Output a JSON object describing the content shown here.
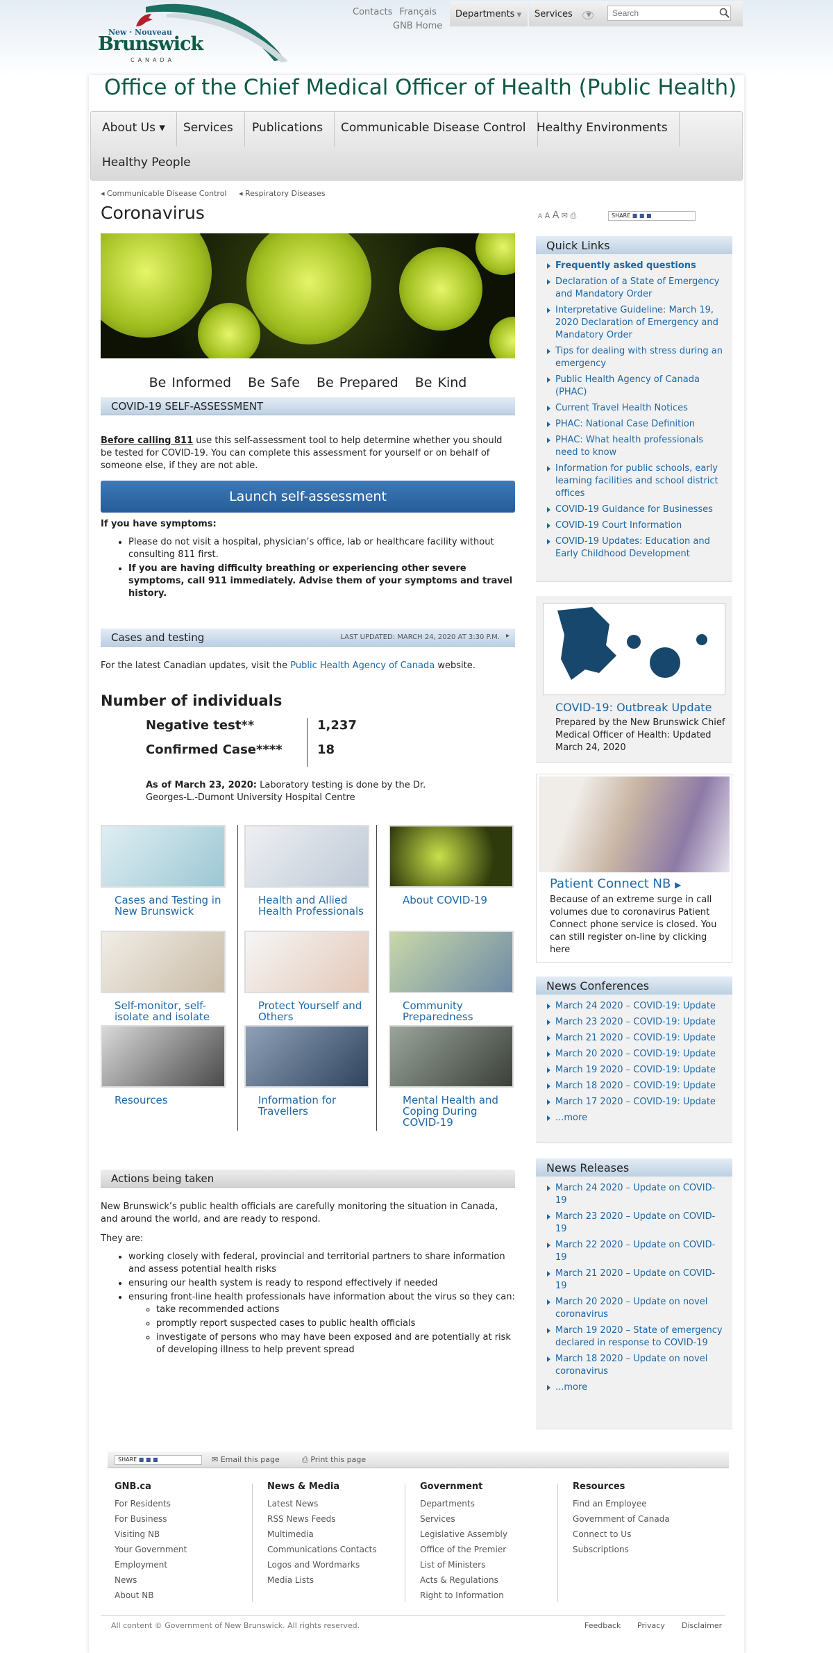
{
  "header": {
    "logo_top": "New · Nouveau",
    "logo_main": "Brunswick",
    "logo_country": "CANADA",
    "contacts": "Contacts",
    "francais": "Français",
    "gnb_home": "GNB Home",
    "departments": "Departments",
    "services": "Services",
    "search_placeholder": "Search"
  },
  "site_title": "Office of the Chief Medical Officer of Health (Public Health)",
  "menu": {
    "about": "About Us ▾",
    "services": "Services",
    "publications": "Publications",
    "cdc": "Communicable Disease Control",
    "env": "Healthy Environments",
    "people": "Healthy People"
  },
  "breadcrumb": [
    "Communicable Disease Control",
    "Respiratory Diseases"
  ],
  "page_title": "Coronavirus",
  "tagline": [
    "Be Informed",
    "Be Safe",
    "Be Prepared",
    "Be Kind"
  ],
  "self_assessment": {
    "heading": "COVID-19 SELF-ASSESSMENT",
    "lead_bold": "Before calling 811",
    "lead": " use this self-assessment tool to help determine whether you should be tested for COVID-19. You can complete this assessment for yourself or on behalf of someone else, if they are not able.",
    "button": "Launch self-assessment",
    "symptoms_heading": "If you have symptoms:",
    "bullet1": "Please do not visit a hospital, physician’s office, lab or healthcare facility without consulting 811 first.",
    "bullet2": "If you are having difficulty breathing or experiencing other severe symptoms, call 911 immediately. Advise them of your symptoms and travel history."
  },
  "cases": {
    "heading": "Cases and testing",
    "updated": "LAST UPDATED: MARCH 24, 2020 AT 3:30 P.M.",
    "intro_a": "For the latest Canadian updates, visit the ",
    "intro_link": "Public Health Agency of Canada",
    "intro_b": " website.",
    "num_heading": "Number of individuals",
    "neg_label": "Negative test**",
    "neg_value": "1,237",
    "conf_label": "Confirmed Case****",
    "conf_value": "18",
    "note_bold": "As of March 23, 2020:",
    "note": " Laboratory testing is done by the Dr. Georges-L.-Dumont University Hospital Centre"
  },
  "tiles": [
    "Cases and Testing in New Brunswick",
    "Health and Allied Health Professionals",
    "About COVID-19",
    "Self-monitor, self-isolate and isolate",
    "Protect Yourself and Others",
    "Community Preparedness",
    "Resources",
    "Information for Travellers",
    "Mental Health and Coping During COVID-19"
  ],
  "actions": {
    "heading": "Actions being taken",
    "p1": "New Brunswick’s public health officials are carefully monitoring the situation in Canada, and around the world, and are ready to respond.",
    "p2": "They are:",
    "items": [
      "working closely with federal, provincial and territorial partners to share information and assess potential health risks",
      "ensuring our health system is ready to respond effectively if needed",
      "ensuring front-line health professionals have information about the virus so they can:"
    ],
    "sub": [
      "take recommended actions",
      "promptly report suspected cases to public health officials",
      "investigate of persons who may have been exposed and are potentially at risk of developing illness to help prevent spread"
    ]
  },
  "share_label": "SHARE",
  "quick_links": {
    "heading": "Quick Links",
    "items": [
      "Frequently asked questions",
      "Declaration of a State of Emergency and Mandatory Order",
      "Interpretative Guideline: March 19, 2020 Declaration of Emergency and Mandatory Order",
      "Tips for dealing with stress during an emergency",
      "Public Health Agency of Canada (PHAC)",
      "Current Travel Health Notices",
      "PHAC: National Case Definition",
      "PHAC: What health professionals need to know",
      "Information for public schools, early learning facilities and school district offices",
      "COVID-19 Guidance for Businesses",
      "COVID-19 Court Information",
      "COVID-19 Updates: Education and Early Childhood Development"
    ]
  },
  "outbreak": {
    "title": "COVID-19: Outbreak Update",
    "text": "Prepared by the New Brunswick Chief Medical Officer of Health: Updated March 24, 2020"
  },
  "patient": {
    "title": "Patient Connect NB",
    "text": "Because of an extreme surge in call volumes due to coronavirus Patient Connect phone service is closed. You can still register on-line by clicking here"
  },
  "conferences": {
    "heading": "News Conferences",
    "items": [
      "March 24 2020 – COVID-19: Update",
      "March 23 2020 – COVID-19: Update",
      "March 21 2020 – COVID-19: Update",
      "March 20 2020 – COVID-19: Update",
      "March 19 2020 – COVID-19: Update",
      "March 18 2020 – COVID-19: Update",
      "March 17 2020 – COVID-19: Update",
      "...more"
    ]
  },
  "releases": {
    "heading": "News Releases",
    "items": [
      "March 24 2020 – Update on COVID-19",
      "March 23 2020 – Update on COVID-19",
      "March 22 2020 – Update on COVID-19",
      "March 21 2020 – Update on COVID-19",
      "March 20 2020 – Update on novel coronavirus",
      "March 19 2020 – State of emergency declared in response to COVID-19",
      "March 18 2020 – Update on novel coronavirus",
      "...more"
    ]
  },
  "toolbar": {
    "share": "SHARE",
    "email": "Email this page",
    "print": "Print this page"
  },
  "footer": {
    "cols": [
      {
        "h": "GNB.ca",
        "items": [
          "For Residents",
          "For Business",
          "Visiting NB",
          "Your Government",
          "Employment",
          "News",
          "About NB"
        ]
      },
      {
        "h": "News & Media",
        "items": [
          "Latest News",
          "RSS News Feeds",
          "Multimedia",
          "Communications Contacts",
          "Logos and Wordmarks",
          "Media Lists"
        ]
      },
      {
        "h": "Government",
        "items": [
          "Departments",
          "Services",
          "Legislative Assembly",
          "Office of the Premier",
          "List of Ministers",
          "Acts & Regulations",
          "Right to Information"
        ]
      },
      {
        "h": "Resources",
        "items": [
          "Find an Employee",
          "Government of Canada",
          "Connect to Us",
          "Subscriptions"
        ]
      }
    ],
    "copyright": "All content © Government of New Brunswick. All rights reserved.",
    "feedback": "Feedback",
    "privacy": "Privacy",
    "disclaimer": "Disclaimer"
  },
  "colors": {
    "brand_green": "#0f5a45",
    "link_blue": "#1d67a6",
    "button_blue": "#2d67a5",
    "section_bar": "#c9d8e6"
  }
}
